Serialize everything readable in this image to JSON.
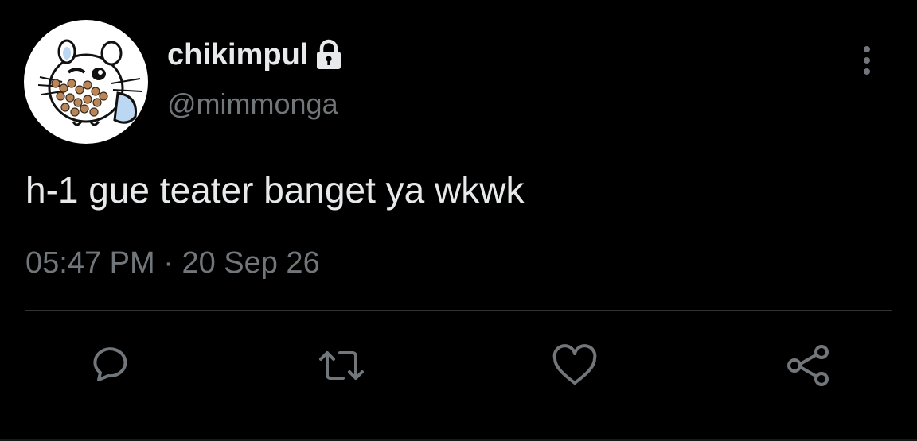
{
  "tweet": {
    "author": {
      "display_name": "chikimpul",
      "handle": "@mimmonga",
      "protected_icon": "lock-icon",
      "avatar_icon": "cartoon-chinchilla-avatar"
    },
    "text": "h-1 gue teater banget ya wkwk",
    "time": "05:47 PM",
    "separator": "·",
    "date": "20 Sep 26",
    "menu_icon": "more-vertical-icon"
  },
  "actions": [
    {
      "name": "reply",
      "icon": "reply-icon"
    },
    {
      "name": "retweet",
      "icon": "retweet-icon"
    },
    {
      "name": "like",
      "icon": "heart-icon"
    },
    {
      "name": "share",
      "icon": "share-icon"
    }
  ],
  "colors": {
    "background": "#000000",
    "primary_text": "#e7e9ea",
    "secondary_text": "#71767b",
    "divider": "#2f3336",
    "icon": "#71767b"
  }
}
